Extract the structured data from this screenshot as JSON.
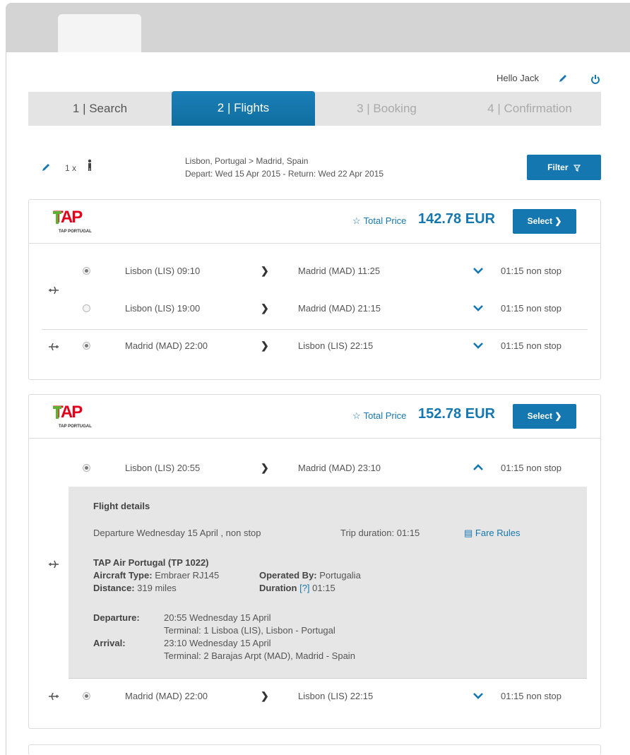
{
  "user": {
    "greeting": "Hello Jack"
  },
  "steps": [
    {
      "label": "1 | Search",
      "state": "done"
    },
    {
      "label": "2 | Flights",
      "state": "active"
    },
    {
      "label": "3 | Booking",
      "state": "pending"
    },
    {
      "label": "4 | Confirmation",
      "state": "pending"
    }
  ],
  "search": {
    "passengers": "1 x",
    "route": "Lisbon, Portugal > Madrid, Spain",
    "dates": "Depart: Wed 15 Apr 2015 - Return: Wed 22 Apr 2015",
    "filter_label": "Filter"
  },
  "results": [
    {
      "airline_logo": "TAP",
      "airline_logo_sub": "TAP PORTUGAL",
      "total_label": "Total Price",
      "total_price": "142.78 EUR",
      "select_label": "Select",
      "outbound": [
        {
          "selected": true,
          "from": "Lisbon (LIS) 09:10",
          "to": "Madrid (MAD) 11:25",
          "duration": "01:15 non stop"
        },
        {
          "selected": false,
          "from": "Lisbon (LIS) 19:00",
          "to": "Madrid (MAD) 21:15",
          "duration": "01:15 non stop"
        }
      ],
      "return": [
        {
          "selected": true,
          "from": "Madrid (MAD) 22:00",
          "to": "Lisbon (LIS) 22:15",
          "duration": "01:15 non stop"
        }
      ]
    },
    {
      "airline_logo": "TAP",
      "airline_logo_sub": "TAP PORTUGAL",
      "total_label": "Total Price",
      "total_price": "152.78 EUR",
      "select_label": "Select",
      "outbound": [
        {
          "selected": true,
          "from": "Lisbon (LIS) 20:55",
          "to": "Madrid (MAD) 23:10",
          "duration": "01:15 non stop"
        }
      ],
      "details": {
        "title": "Flight details",
        "departure_summary": "Departure Wednesday 15 April , non stop",
        "trip_duration": "Trip duration: 01:15",
        "fare_rules": "Fare Rules",
        "flight_name": "TAP Air Portugal (TP 1022)",
        "aircraft_label": "Aircraft Type:",
        "aircraft_value": "Embraer RJ145",
        "operated_label": "Operated By:",
        "operated_value": "Portugalia",
        "distance_label": "Distance:",
        "distance_value": "319 miles",
        "duration_label": "Duration",
        "duration_help": "[?]",
        "duration_value": "01:15",
        "departure_label": "Departure:",
        "departure_time": "20:55 Wednesday 15 April",
        "departure_terminal": "Terminal: 1 Lisboa (LIS), Lisbon - Portugal",
        "arrival_label": "Arrival:",
        "arrival_time": "23:10 Wednesday 15 April",
        "arrival_terminal": "Terminal: 2 Barajas Arpt (MAD), Madrid - Spain"
      },
      "return": [
        {
          "selected": true,
          "from": "Madrid (MAD) 22:00",
          "to": "Lisbon (LIS) 22:15",
          "duration": "01:15 non stop"
        }
      ]
    }
  ],
  "colors": {
    "accent": "#1577b0",
    "step_bar": "#e4e4e4",
    "details_bg": "#e6e6e6"
  },
  "icons": [
    "pencil-icon",
    "power-icon",
    "person-icon",
    "filter-icon",
    "star-icon",
    "chevron-right-icon",
    "chevron-down-icon",
    "chevron-up-icon",
    "plane-departure-icon",
    "plane-return-icon",
    "fare-rules-icon"
  ]
}
